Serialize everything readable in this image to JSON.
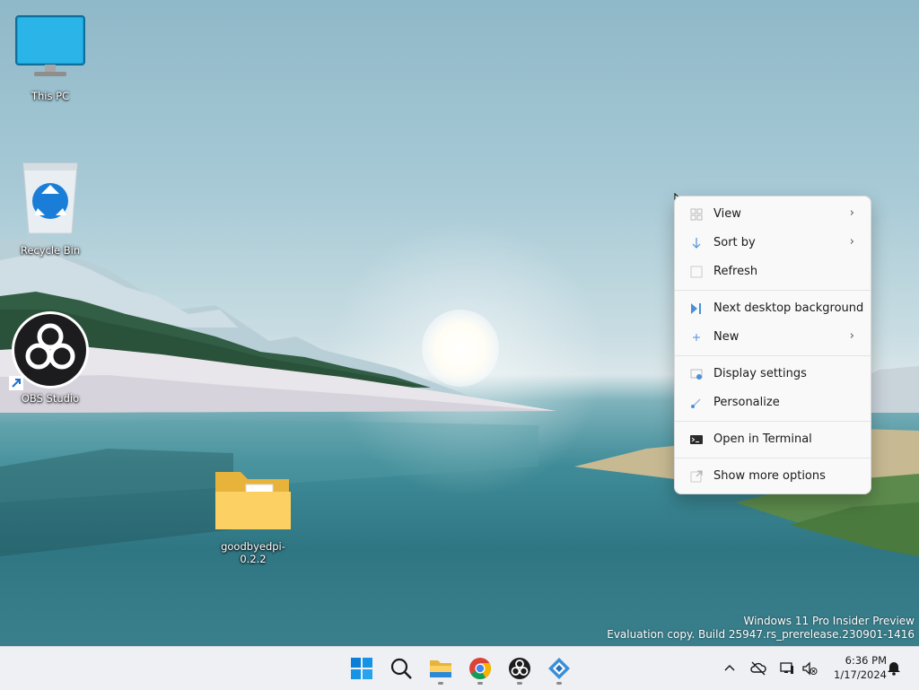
{
  "desktop": {
    "icons": [
      {
        "label": "This PC"
      },
      {
        "label": "Recycle Bin"
      },
      {
        "label": "OBS Studio"
      },
      {
        "label": "goodbyedpi-0.2.2"
      }
    ],
    "watermark": {
      "line1": "Windows 11 Pro Insider Preview",
      "line2": "Evaluation copy. Build 25947.rs_prerelease.230901-1416"
    }
  },
  "context_menu": {
    "items": [
      {
        "label": "View",
        "icon": "view-grid-icon",
        "submenu": true
      },
      {
        "label": "Sort by",
        "icon": "sort-arrow-icon",
        "submenu": true
      },
      {
        "label": "Refresh",
        "icon": "refresh-icon",
        "submenu": false
      },
      {
        "label": "Next desktop background",
        "icon": "next-background-icon",
        "submenu": false
      },
      {
        "label": "New",
        "icon": "plus-icon",
        "submenu": true
      },
      {
        "label": "Display settings",
        "icon": "display-settings-icon",
        "submenu": false
      },
      {
        "label": "Personalize",
        "icon": "brush-icon",
        "submenu": false
      },
      {
        "label": "Open in Terminal",
        "icon": "terminal-icon",
        "submenu": false
      },
      {
        "label": "Show more options",
        "icon": "more-options-icon",
        "submenu": false
      }
    ]
  },
  "taskbar": {
    "apps": [
      "start-icon",
      "search-icon",
      "file-explorer-icon",
      "chrome-icon",
      "obs-icon",
      "app-icon"
    ],
    "clock": {
      "time": "6:36 PM",
      "date": "1/17/2024"
    }
  },
  "colors": {
    "accent": "#0067c0",
    "taskbar": "#eef0f4",
    "menu": "#f9f9f9"
  }
}
